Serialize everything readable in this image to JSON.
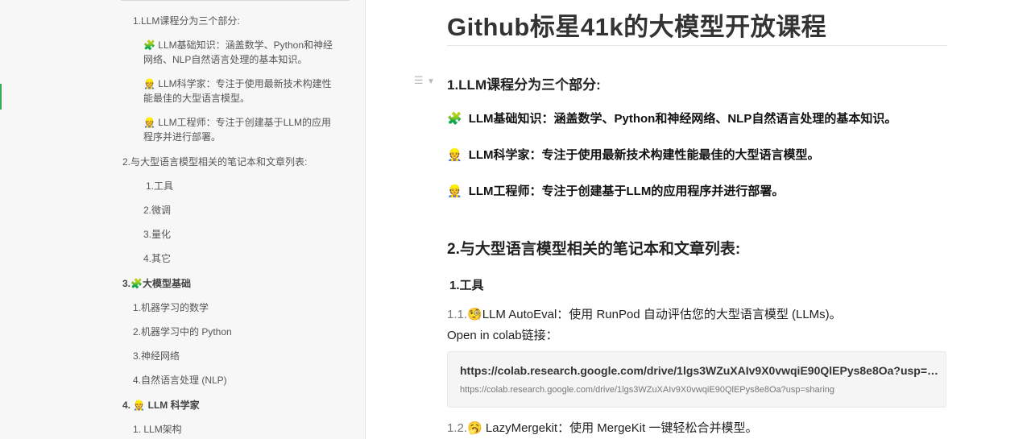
{
  "sidebar": {
    "items": [
      {
        "text": "1.LLM课程分为三个部分:",
        "icon": ""
      },
      {
        "text": " LLM基础知识：涵盖数学、Python和神经",
        "icon": "🧩"
      },
      {
        "text": "网络、NLP自然语言处理的基本知识。",
        "icon": ""
      },
      {
        "text": " LLM科学家：专注于使用最新技术构建性",
        "icon": "👷"
      },
      {
        "text": "能最佳的大型语言模型。",
        "icon": ""
      },
      {
        "text": " LLM工程师：专注于创建基于LLM的应用",
        "icon": "👷"
      },
      {
        "text": "程序并进行部署。",
        "icon": ""
      },
      {
        "text": "2.与大型语言模型相关的笔记本和文章列表:",
        "icon": ""
      },
      {
        "text": "1.工具",
        "icon": ""
      },
      {
        "text": "2.微调",
        "icon": ""
      },
      {
        "text": "3.量化",
        "icon": ""
      },
      {
        "text": "4.其它",
        "icon": ""
      },
      {
        "text": "大模型基础",
        "prefix": "3.",
        "icon": "🧩"
      },
      {
        "text": "1.机器学习的数学",
        "icon": ""
      },
      {
        "text": "2.机器学习中的 Python",
        "icon": ""
      },
      {
        "text": "3.神经网络",
        "icon": ""
      },
      {
        "text": "4.自然语言处理 (NLP)",
        "icon": ""
      },
      {
        "text": " LLM 科学家",
        "prefix": "4. ",
        "icon": "👷"
      },
      {
        "text": "1. LLM架构",
        "icon": ""
      }
    ]
  },
  "doc": {
    "title": "Github标星41k的大模型开放课程",
    "section1": "1.LLM课程分为三个部分:",
    "bullets": [
      {
        "icon": "🧩",
        "text": "LLM基础知识：涵盖数学、Python和神经网络、NLP自然语言处理的基本知识。"
      },
      {
        "icon": "👷",
        "text": "LLM科学家：专注于使用最新技术构建性能最佳的大型语言模型。"
      },
      {
        "icon": "👷",
        "text": "LLM工程师：专注于创建基于LLM的应用程序并进行部署。"
      }
    ],
    "section2": "2.与大型语言模型相关的笔记本和文章列表:",
    "sub1": "1.工具",
    "item1_num": "1.1.",
    "item1_icon": "🧐",
    "item1_text": "LLM AutoEval：使用 RunPod 自动评估您的大型语言模型 (LLMs)。",
    "colab_label": "Open in colab链接：",
    "link_title": "https://colab.research.google.com/drive/1lgs3WZuXAIv9X0vwqiE90QlEPys8e8Oa?usp=sharing",
    "link_url": "https://colab.research.google.com/drive/1lgs3WZuXAIv9X0vwqiE90QlEPys8e8Oa?usp=sharing",
    "item2_num": "1.2.",
    "item2_icon": "🥱",
    "item2_text": " LazyMergekit：使用 MergeKit 一键轻松合并模型。"
  },
  "icons": {
    "drag_handle": "drag-handle-icon",
    "collapse": "caret-down-icon"
  },
  "colors": {
    "accent": "#3aa655",
    "sidebar_bg": "#f7f7f7",
    "card_bg": "#f5f5f5"
  }
}
